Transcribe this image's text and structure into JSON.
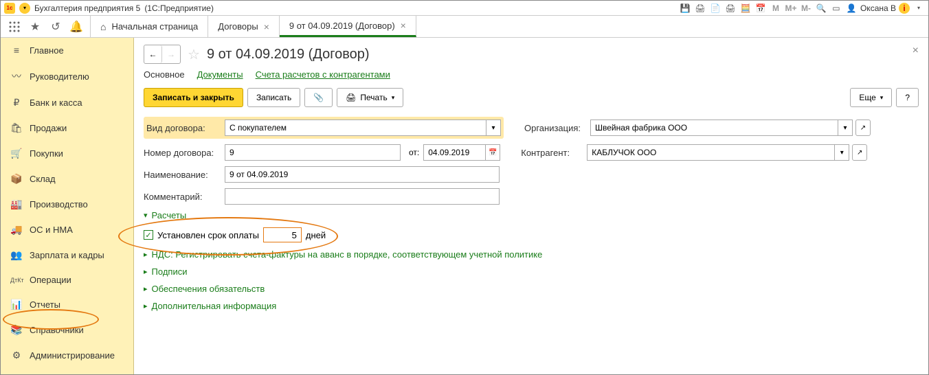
{
  "titlebar": {
    "app": "Бухгалтерия предприятия 5",
    "platform": "(1С:Предприятие)",
    "user": "Оксана В",
    "mem": {
      "m": "M",
      "mplus": "M+",
      "mminus": "M-"
    }
  },
  "tabs": {
    "home": "Начальная страница",
    "contracts": "Договоры",
    "current": "9 от 04.09.2019 (Договор)"
  },
  "sidebar": [
    {
      "label": "Главное",
      "icon": "≡"
    },
    {
      "label": "Руководителю",
      "icon": "〰"
    },
    {
      "label": "Банк и касса",
      "icon": "₽"
    },
    {
      "label": "Продажи",
      "icon": "🛍"
    },
    {
      "label": "Покупки",
      "icon": "🛒"
    },
    {
      "label": "Склад",
      "icon": "📦"
    },
    {
      "label": "Производство",
      "icon": "🏭"
    },
    {
      "label": "ОС и НМА",
      "icon": "🚚"
    },
    {
      "label": "Зарплата и кадры",
      "icon": "👥"
    },
    {
      "label": "Операции",
      "icon": "ДтКт"
    },
    {
      "label": "Отчеты",
      "icon": "📊"
    },
    {
      "label": "Справочники",
      "icon": "📚"
    },
    {
      "label": "Администрирование",
      "icon": "⚙"
    }
  ],
  "page": {
    "title": "9 от 04.09.2019 (Договор)"
  },
  "subtabs": {
    "main": "Основное",
    "docs": "Документы",
    "accounts": "Счета расчетов с контрагентами"
  },
  "actions": {
    "save_close": "Записать и закрыть",
    "save": "Записать",
    "print": "Печать",
    "more": "Еще",
    "help": "?"
  },
  "form": {
    "contract_type_label": "Вид договора:",
    "contract_type_value": "С покупателем",
    "number_label": "Номер договора:",
    "number_value": "9",
    "from_label": "от:",
    "date_value": "04.09.2019",
    "name_label": "Наименование:",
    "name_value": "9 от 04.09.2019",
    "comment_label": "Комментарий:",
    "comment_value": "",
    "org_label": "Организация:",
    "org_value": "Швейная фабрика ООО",
    "counterparty_label": "Контрагент:",
    "counterparty_value": "КАБЛУЧОК ООО"
  },
  "sections": {
    "payments": "Расчеты",
    "payment_term": "Установлен срок оплаты",
    "days_value": "5",
    "days_label": "дней",
    "vat": "НДС: Регистрировать счета-фактуры на аванс в порядке, соответствующем учетной политике",
    "signs": "Подписи",
    "collateral": "Обеспечения обязательств",
    "extra": "Дополнительная информация"
  }
}
